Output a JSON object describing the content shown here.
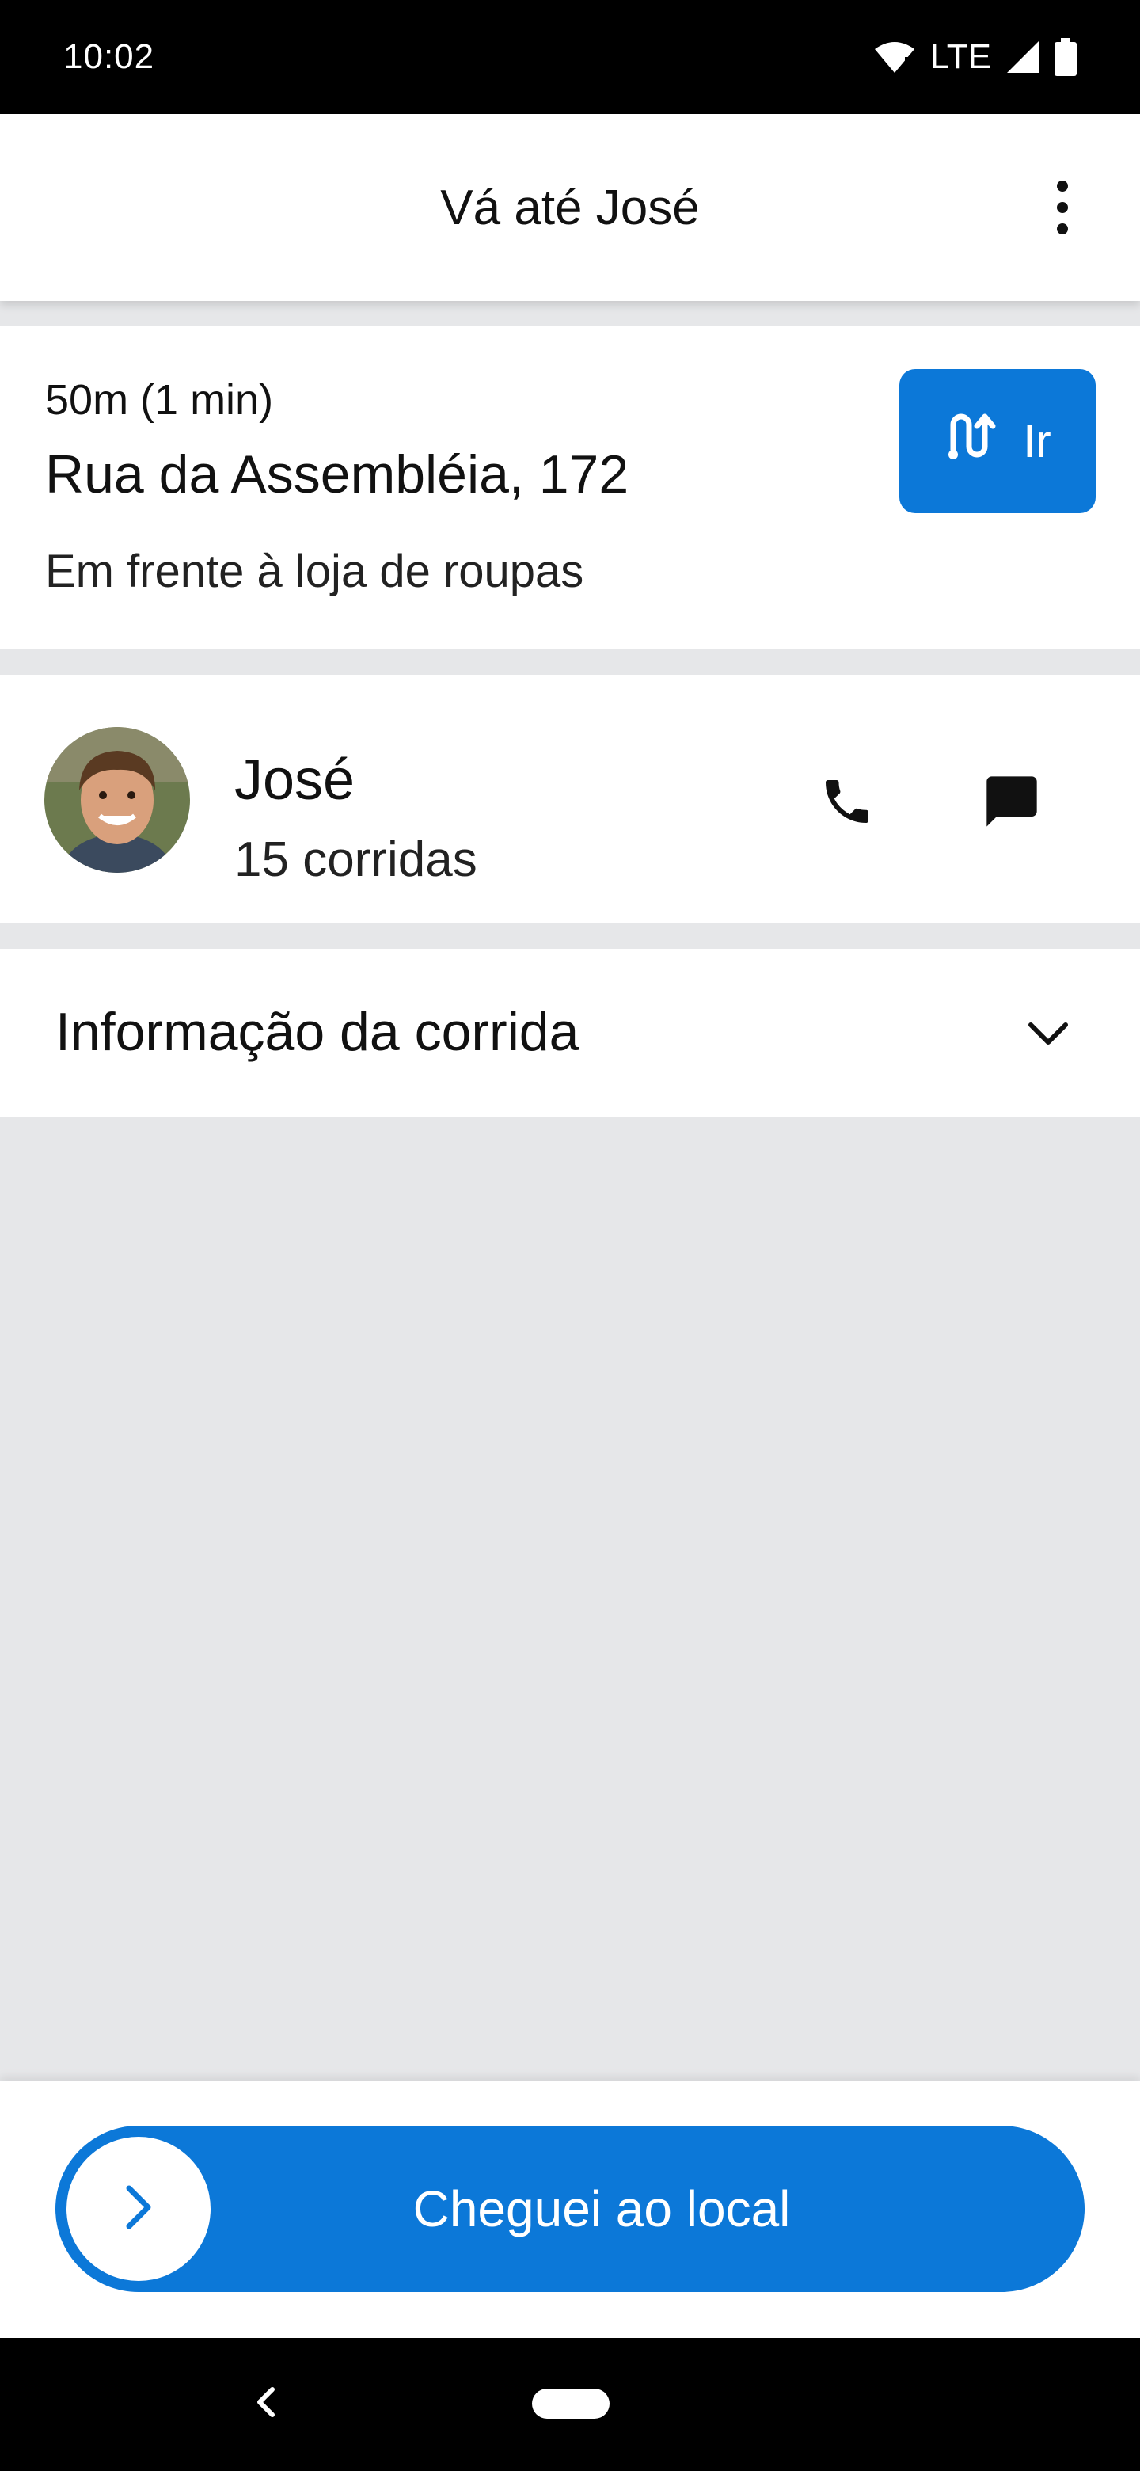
{
  "status_bar": {
    "time": "10:02",
    "network": "LTE"
  },
  "header": {
    "title": "Vá até José",
    "menu_icon": "more-vert-icon"
  },
  "destination": {
    "eta": "50m (1 min)",
    "address": "Rua da Assembléia, 172",
    "note": "Em frente à loja de roupas",
    "go_label": "Ir",
    "go_icon": "route-icon"
  },
  "rider": {
    "name": "José",
    "rides": "15 corridas",
    "call_icon": "phone-icon",
    "message_icon": "message-icon"
  },
  "ride_info": {
    "title": "Informação da corrida",
    "expand_icon": "chevron-down-icon"
  },
  "arrival": {
    "label": "Cheguei ao local",
    "knob_icon": "chevron-right-icon"
  },
  "colors": {
    "accent": "#0c78d8",
    "background": "#e6e7e9"
  }
}
